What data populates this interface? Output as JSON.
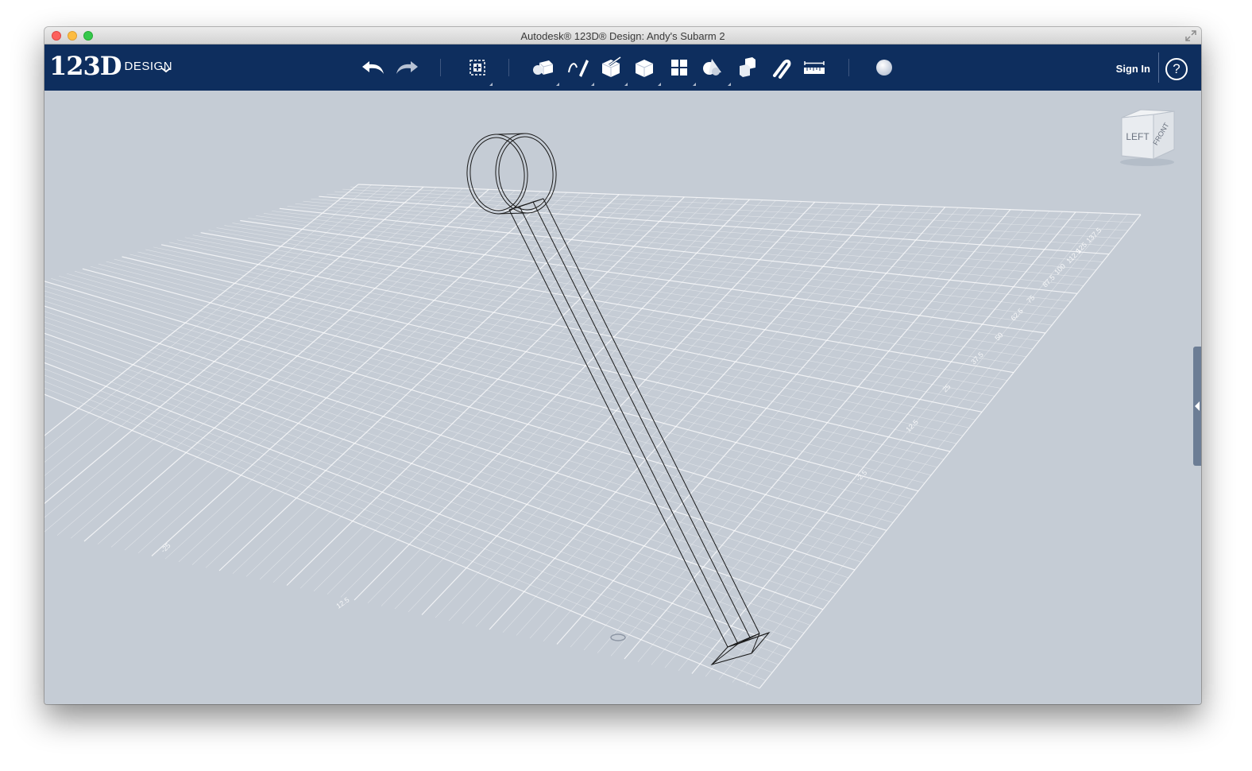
{
  "window": {
    "title": "Autodesk® 123D® Design: Andy's Subarm 2"
  },
  "toolbar": {
    "logo_main": "123D",
    "logo_word": "DESIGN",
    "sign_in_label": "Sign In",
    "help_glyph": "?",
    "tools": [
      {
        "name": "undo-icon"
      },
      {
        "name": "redo-icon"
      },
      {
        "name": "transform-icon"
      },
      {
        "name": "primitives-icon"
      },
      {
        "name": "sketch-icon"
      },
      {
        "name": "construct-icon"
      },
      {
        "name": "modify-icon"
      },
      {
        "name": "pattern-icon"
      },
      {
        "name": "grouping-icon"
      },
      {
        "name": "combine-icon"
      },
      {
        "name": "snap-icon"
      },
      {
        "name": "measure-icon"
      },
      {
        "name": "material-icon"
      }
    ]
  },
  "viewcube": {
    "left_label": "LEFT",
    "front_label": "FRONT"
  },
  "grid_labels": [
    "-25",
    "12.5",
    "-2.5",
    "12.5",
    "25",
    "37.5",
    "50",
    "62.5",
    "75",
    "87.5",
    "100",
    "112.5",
    "125",
    "137.5"
  ],
  "colors": {
    "toolbar_bg": "#0e2e5e",
    "viewport_bg": "#c5ccd5",
    "grid_line": "#ffffff",
    "model_line": "#1a1a1a"
  }
}
